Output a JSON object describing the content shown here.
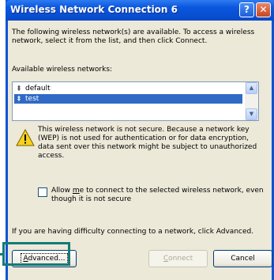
{
  "window": {
    "title": "Wireless Network Connection 6",
    "help_glyph": "?",
    "close_glyph": "✕"
  },
  "dialog": {
    "intro": "The following wireless network(s) are available. To access a wireless network, select it from the list, and then click Connect.",
    "available_label": "Available wireless networks:",
    "networks": [
      {
        "label": "default",
        "icon": "wireless-signal-icon",
        "selected": false
      },
      {
        "label": "test",
        "icon": "wireless-signal-icon",
        "selected": true
      }
    ],
    "warning": "This wireless network is not secure. Because a network key (WEP) is not used for authentication or for data encryption, data sent over this network might be subject to unauthorized access.",
    "allow_checkbox": {
      "label_pre": "Allow ",
      "label_mnemonic": "m",
      "label_post": "e to connect to the selected wireless network, even though it is not secure",
      "checked": false
    },
    "difficulty_text": "If you are having difficulty connecting to a network, click Advanced."
  },
  "buttons": {
    "advanced_pre": "",
    "advanced_mnemonic": "A",
    "advanced_post": "dvanced...",
    "connect_pre": "",
    "connect_mnemonic": "C",
    "connect_post": "onnect",
    "cancel": "Cancel"
  },
  "colors": {
    "titlebar": "#0a58e0",
    "selection": "#316ac5",
    "highlight_box": "#147b78"
  }
}
